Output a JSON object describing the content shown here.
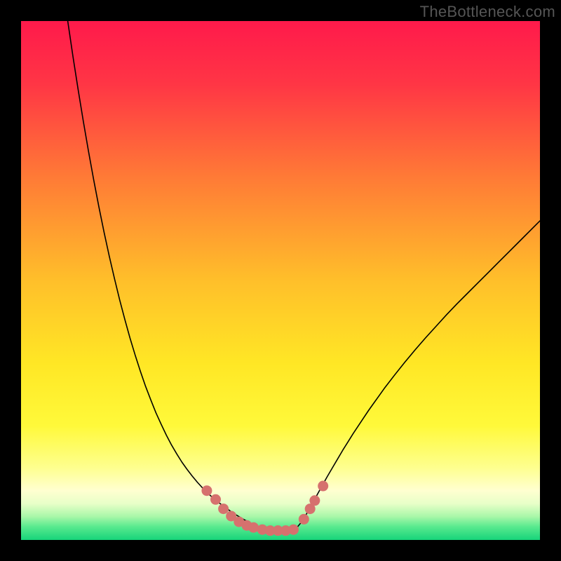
{
  "watermark": "TheBottleneck.com",
  "chart_data": {
    "type": "line",
    "title": "",
    "xlabel": "",
    "ylabel": "",
    "xlim": [
      0,
      100
    ],
    "ylim": [
      0,
      100
    ],
    "background_gradient": {
      "stops": [
        {
          "offset": 0.0,
          "color": "#ff1a4b"
        },
        {
          "offset": 0.12,
          "color": "#ff3545"
        },
        {
          "offset": 0.3,
          "color": "#ff7a36"
        },
        {
          "offset": 0.5,
          "color": "#ffbf2a"
        },
        {
          "offset": 0.66,
          "color": "#ffe725"
        },
        {
          "offset": 0.78,
          "color": "#fff93a"
        },
        {
          "offset": 0.86,
          "color": "#feff8e"
        },
        {
          "offset": 0.905,
          "color": "#ffffd0"
        },
        {
          "offset": 0.93,
          "color": "#e8ffc8"
        },
        {
          "offset": 0.955,
          "color": "#a8f7a8"
        },
        {
          "offset": 0.975,
          "color": "#57e98e"
        },
        {
          "offset": 1.0,
          "color": "#17d47a"
        }
      ]
    },
    "series": [
      {
        "name": "curve",
        "color": "#000000",
        "stroke_width": 1.6,
        "x": [
          9,
          10,
          11,
          12,
          13,
          14,
          15,
          16,
          17,
          18,
          19,
          20,
          21,
          22,
          23,
          24,
          25,
          26,
          27,
          28,
          29,
          30,
          31,
          32,
          33,
          34,
          35,
          36,
          37,
          38,
          39,
          40,
          41,
          42,
          43,
          44,
          45,
          46,
          47,
          48,
          49,
          50,
          51,
          52,
          53,
          54,
          55,
          56,
          57,
          58,
          59,
          60,
          61,
          62,
          63,
          64,
          65,
          66,
          67,
          68,
          69,
          70,
          72,
          74,
          76,
          78,
          80,
          82,
          84,
          86,
          88,
          90,
          92,
          94,
          96,
          98,
          100
        ],
        "y": [
          100,
          93.2,
          86.8,
          80.7,
          74.9,
          69.4,
          64.2,
          59.3,
          54.7,
          50.4,
          46.3,
          42.5,
          38.9,
          35.6,
          32.5,
          29.6,
          27.0,
          24.5,
          22.3,
          20.2,
          18.3,
          16.6,
          15.0,
          13.6,
          12.3,
          11.1,
          10.0,
          9.0,
          8.1,
          7.3,
          6.5,
          5.8,
          5.1,
          4.5,
          3.9,
          3.4,
          2.6,
          2.2,
          1.9,
          1.7,
          1.5,
          1.3,
          1.3,
          1.5,
          2.2,
          3.4,
          5.0,
          6.8,
          8.6,
          10.4,
          12.2,
          13.9,
          15.6,
          17.3,
          18.9,
          20.5,
          22.0,
          23.5,
          25.0,
          26.4,
          27.8,
          29.2,
          31.8,
          34.3,
          36.7,
          39.0,
          41.2,
          43.4,
          45.5,
          47.5,
          49.5,
          51.5,
          53.5,
          55.5,
          57.5,
          59.5,
          61.5
        ]
      }
    ],
    "markers": {
      "name": "dots",
      "color": "#d6716e",
      "radius": 7.5,
      "points": [
        {
          "x": 35.8,
          "y": 9.5
        },
        {
          "x": 37.5,
          "y": 7.8
        },
        {
          "x": 39.0,
          "y": 6.0
        },
        {
          "x": 40.5,
          "y": 4.6
        },
        {
          "x": 42.0,
          "y": 3.5
        },
        {
          "x": 43.5,
          "y": 2.8
        },
        {
          "x": 44.8,
          "y": 2.4
        },
        {
          "x": 46.5,
          "y": 2.0
        },
        {
          "x": 48.0,
          "y": 1.8
        },
        {
          "x": 49.5,
          "y": 1.8
        },
        {
          "x": 51.0,
          "y": 1.8
        },
        {
          "x": 52.5,
          "y": 2.0
        },
        {
          "x": 54.5,
          "y": 4.0
        },
        {
          "x": 55.7,
          "y": 6.0
        },
        {
          "x": 56.6,
          "y": 7.6
        },
        {
          "x": 58.2,
          "y": 10.4
        }
      ]
    }
  }
}
